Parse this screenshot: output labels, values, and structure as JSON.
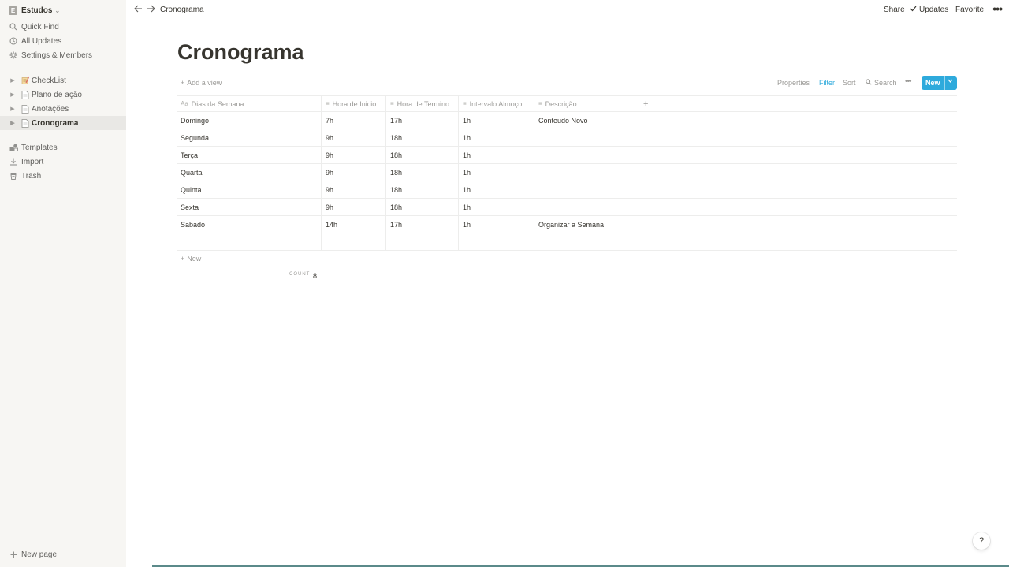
{
  "sidebar": {
    "workspace": {
      "initial": "E",
      "name": "Estudos",
      "chevron": "⌄"
    },
    "top_items": [
      {
        "label": "Quick Find",
        "icon": "search-icon"
      },
      {
        "label": "All Updates",
        "icon": "clock-icon"
      },
      {
        "label": "Settings & Members",
        "icon": "gear-icon"
      }
    ],
    "pages": [
      {
        "label": "CheckList",
        "icon": "memo-icon"
      },
      {
        "label": "Plano de ação",
        "icon": "page-icon"
      },
      {
        "label": "Anotações",
        "icon": "page-icon"
      },
      {
        "label": "Cronograma",
        "icon": "page-icon",
        "active": true
      }
    ],
    "bottom_items": [
      {
        "label": "Templates",
        "icon": "templates-icon"
      },
      {
        "label": "Import",
        "icon": "import-icon"
      },
      {
        "label": "Trash",
        "icon": "trash-icon"
      }
    ],
    "new_page": "New page"
  },
  "topbar": {
    "breadcrumb": "Cronograma",
    "share": "Share",
    "updates": "Updates",
    "favorite": "Favorite",
    "more": "•••"
  },
  "page": {
    "title": "Cronograma"
  },
  "viewbar": {
    "add_view": "Add a view",
    "properties": "Properties",
    "filter": "Filter",
    "sort": "Sort",
    "search": "Search",
    "more": "•••",
    "new": "New"
  },
  "table": {
    "columns": [
      "Dias da Semana",
      "Hora de Inicio",
      "Hora de Termino",
      "Intervalo Almoço",
      "Descrição"
    ],
    "rows": [
      [
        "Domingo",
        "7h",
        "17h",
        "1h",
        "Conteudo Novo"
      ],
      [
        "Segunda",
        "9h",
        "18h",
        "1h",
        ""
      ],
      [
        "Terça",
        "9h",
        "18h",
        "1h",
        ""
      ],
      [
        "Quarta",
        "9h",
        "18h",
        "1h",
        ""
      ],
      [
        "Quinta",
        "9h",
        "18h",
        "1h",
        ""
      ],
      [
        "Sexta",
        "9h",
        "18h",
        "1h",
        ""
      ],
      [
        "Sabado",
        "14h",
        "17h",
        "1h",
        "Organizar a Semana"
      ],
      [
        "",
        "",
        "",
        "",
        ""
      ]
    ],
    "add_row": "New",
    "count_label": "COUNT",
    "count_value": "8"
  },
  "help": "?",
  "colors": {
    "accent": "#2eaadc",
    "sidebar_bg": "#f7f6f3",
    "text": "#37352f",
    "muted": "#9b9a97"
  }
}
